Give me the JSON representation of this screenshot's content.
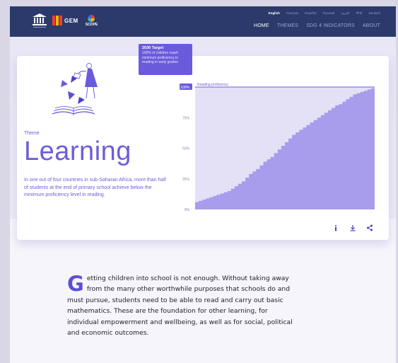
{
  "header": {
    "logos": {
      "gem": "GEM",
      "scope": "SCOPE"
    },
    "languages": [
      {
        "label": "English",
        "active": true
      },
      {
        "label": "Français",
        "active": false
      },
      {
        "label": "Español",
        "active": false
      },
      {
        "label": "Русский",
        "active": false
      },
      {
        "label": "العربية",
        "active": false
      },
      {
        "label": "中文",
        "active": false
      },
      {
        "label": "Deutsch",
        "active": false
      }
    ],
    "nav": [
      {
        "label": "HOME",
        "active": true
      },
      {
        "label": "THEMES",
        "active": false
      },
      {
        "label": "SDG 4 INDICATORS",
        "active": false
      },
      {
        "label": "ABOUT",
        "active": false
      }
    ]
  },
  "hero": {
    "theme_label": "Theme",
    "title": "Learning",
    "description": "In one out of four countries in sub-Saharan Africa, more than half of students at the end of primary school achieve below the minimum proficiency level in reading.",
    "tooltip": {
      "title": "2030 Target",
      "body": "100% of children reach minimum proficiency in reading in early grades"
    },
    "actions": [
      {
        "name": "info",
        "icon": "info-icon"
      },
      {
        "name": "download",
        "icon": "download-icon"
      },
      {
        "name": "share",
        "icon": "share-icon"
      }
    ]
  },
  "chart_data": {
    "type": "area",
    "title": "",
    "xlabel": "",
    "ylabel": "",
    "ylim": [
      0,
      100
    ],
    "y_ticks": [
      "0%",
      "25%",
      "50%",
      "75%",
      "100%"
    ],
    "reference_line": {
      "value": 100,
      "label": "Reading proficiency"
    },
    "series": [
      {
        "values": [
          6,
          7,
          8,
          9,
          10,
          11,
          12,
          13,
          14,
          15,
          17,
          19,
          21,
          23,
          26,
          29,
          31,
          33,
          36,
          39,
          41,
          43,
          46,
          49,
          52,
          55,
          58,
          61,
          63,
          65,
          67,
          69,
          71,
          73,
          75,
          77,
          79,
          81,
          83,
          85,
          86,
          88,
          90,
          92,
          94,
          95,
          96,
          97,
          98,
          99
        ]
      }
    ],
    "colors": {
      "fill": "#a79dec",
      "band": "#e4e1f7",
      "line": "#6a5bdc"
    }
  },
  "article": {
    "dropcap": "G",
    "text": "etting children into school is not enough. Without taking away from the many other worthwhile purposes that schools do and must pursue, students need to be able to read and carry out basic mathematics. These are the foundation for other learning, for individual empowerment and wellbeing, as well as for social, political and economic outcomes."
  }
}
